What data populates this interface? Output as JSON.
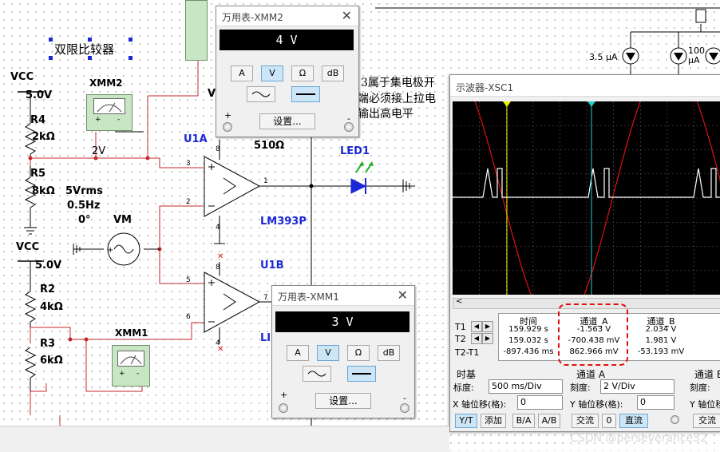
{
  "schematic": {
    "title_label": "双限比较器",
    "vcc_top": {
      "name": "VCC",
      "value": "5.0V"
    },
    "r4": {
      "name": "R4",
      "value": "2kΩ"
    },
    "r5": {
      "name": "R5",
      "value": "8kΩ"
    },
    "v_label_2v": "2V",
    "xmm2_name": "XMM2",
    "source": {
      "rms": "5Vrms",
      "freq": "0.5Hz",
      "phase": "0°",
      "name": "VM"
    },
    "vcc_bottom": {
      "name": "VCC",
      "value": "5.0V"
    },
    "r2": {
      "name": "R2",
      "value": "4kΩ"
    },
    "r3": {
      "name": "R3",
      "value": "6kΩ"
    },
    "xmm1_name": "XMM1",
    "u1a": "U1A",
    "u1b": "U1B",
    "r_pullup": "510Ω",
    "led": "LED1",
    "ic_part": "LM393P",
    "lm_fragment": "LI",
    "v_fragment": "V",
    "note_lines": [
      "3属于集电极开",
      "端必须接上拉电",
      "输出高电平"
    ],
    "current_sources": [
      {
        "value": "3.5 μA"
      },
      {
        "value": "100 μA"
      }
    ],
    "pins": {
      "u1a_in_plus": "3",
      "u1a_in_minus": "2",
      "u1a_out": "1",
      "u1a_vcc": "8",
      "u1a_gnd": "4",
      "u1b_in_plus": "5",
      "u1b_in_minus": "6",
      "u1b_out": "7",
      "u1b_vcc": "8",
      "u1b_gnd": "4"
    },
    "meter_plus": "+",
    "meter_minus": "-"
  },
  "xmm2_window": {
    "title": "万用表-XMM2",
    "reading": "4 V",
    "mode_buttons": [
      "A",
      "V",
      "Ω",
      "dB"
    ],
    "selected_mode": "V",
    "settings_label": "设置...",
    "plus": "+",
    "minus": "-"
  },
  "xmm1_window": {
    "title": "万用表-XMM1",
    "reading": "3 V",
    "mode_buttons": [
      "A",
      "V",
      "Ω",
      "dB"
    ],
    "selected_mode": "V",
    "settings_label": "设置...",
    "plus": "+",
    "minus": "-"
  },
  "oscilloscope": {
    "title": "示波器-XSC1",
    "table": {
      "headers": [
        "时间",
        "通道_A",
        "通道_B"
      ],
      "rows": [
        {
          "label": "T1",
          "time": "159.929 s",
          "cha": "-1.563 V",
          "chb": "2.034 V"
        },
        {
          "label": "T2",
          "time": "159.032 s",
          "cha": "-700.438 mV",
          "chb": "1.981 V"
        },
        {
          "label": "T2-T1",
          "time": "-897.436 ms",
          "cha": "862.966 mV",
          "chb": "-53.193 mV"
        }
      ]
    },
    "timebase": {
      "heading": "时基",
      "scale_label": "标度:",
      "scale_value": "500 ms/Div",
      "xpos_label": "X 轴位移(格):",
      "xpos_value": "0",
      "buttons": [
        "Y/T",
        "添加",
        "B/A",
        "A/B"
      ],
      "selected": "Y/T"
    },
    "channel_a": {
      "heading": "通道 A",
      "scale_label": "刻度:",
      "scale_value": "2 V/Div",
      "ypos_label": "Y 轴位移(格):",
      "ypos_value": "0",
      "coupling": [
        "交流",
        "0",
        "直流"
      ],
      "selected": "直流"
    },
    "channel_b": {
      "heading": "通道 B",
      "scale_label": "刻度:",
      "ypos_label": "Y 轴位移",
      "coupling_first": "交流"
    },
    "colors": {
      "channel_a_trace": "#e01010",
      "channel_b_trace": "#ffffff",
      "cursor1": "#f0f000",
      "cursor2": "#22cccc",
      "screen": "#000000",
      "highlight": "#e01010"
    }
  },
  "watermark": "CSDN @perseverance52"
}
